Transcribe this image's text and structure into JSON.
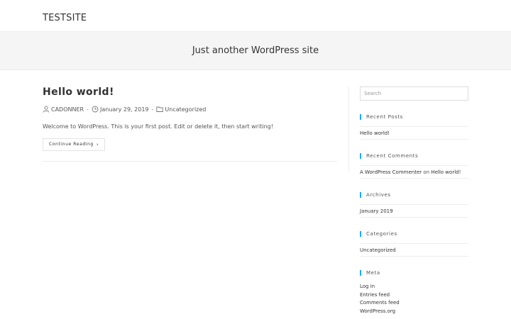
{
  "site": {
    "title": "TESTSITE",
    "tagline": "Just another WordPress site"
  },
  "post": {
    "title": "Hello world!",
    "author": "CADONNER",
    "date": "January 29, 2019",
    "category": "Uncategorized",
    "excerpt": "Welcome to WordPress. This is your first post. Edit or delete it, then start writing!",
    "continue_label": "Continue Reading"
  },
  "sidebar": {
    "search_placeholder": "Search",
    "recent_posts": {
      "title": "Recent Posts",
      "items": [
        "Hello world!"
      ]
    },
    "recent_comments": {
      "title": "Recent Comments",
      "author": "A WordPress Commenter",
      "on": "on",
      "post": "Hello world!"
    },
    "archives": {
      "title": "Archives",
      "items": [
        "January 2019"
      ]
    },
    "categories": {
      "title": "Categories",
      "items": [
        "Uncategorized"
      ]
    },
    "meta": {
      "title": "Meta",
      "items": [
        "Log in",
        "Entries feed",
        "Comments feed",
        "WordPress.org"
      ]
    }
  },
  "colors": {
    "accent": "#13aff0",
    "hero_bg": "#f5f5f5"
  },
  "icons": {
    "author": "user-icon",
    "date": "clock-icon",
    "category": "folder-icon",
    "continue": "chevron-right-icon"
  }
}
